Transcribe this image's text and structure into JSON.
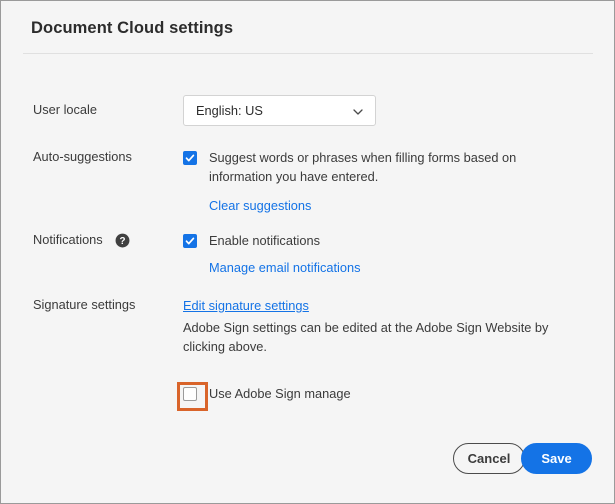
{
  "dialog": {
    "title": "Document Cloud settings"
  },
  "rows": {
    "user_locale": {
      "label": "User locale",
      "select": {
        "value": "English: US",
        "icon": "chevron-down-icon"
      }
    },
    "auto_suggestions": {
      "label": "Auto-suggestions",
      "checkbox": {
        "checked": true,
        "text": "Suggest words or phrases when filling forms based on information you have entered."
      },
      "link": {
        "text": "Clear suggestions",
        "underline": false
      }
    },
    "notifications": {
      "label": "Notifications",
      "help_icon": "help-circle-icon",
      "checkbox": {
        "checked": true,
        "text": "Enable notifications"
      },
      "link": {
        "text": "Manage email notifications",
        "underline": false
      }
    },
    "signature_settings": {
      "label": "Signature settings",
      "link": {
        "text": "Edit signature settings",
        "underline": true
      },
      "description": "Adobe Sign settings can be edited at the Adobe Sign Website by clicking above.",
      "checkbox": {
        "checked": false,
        "text": "Use Adobe Sign manage",
        "highlighted": true
      }
    }
  },
  "footer": {
    "cancel_label": "Cancel",
    "save_label": "Save"
  },
  "colors": {
    "accent_blue": "#1473e6",
    "link_blue": "#1473e6",
    "highlight_orange": "#d9642a",
    "panel_bg": "#f5f5f5",
    "text": "#3b3b3b"
  }
}
